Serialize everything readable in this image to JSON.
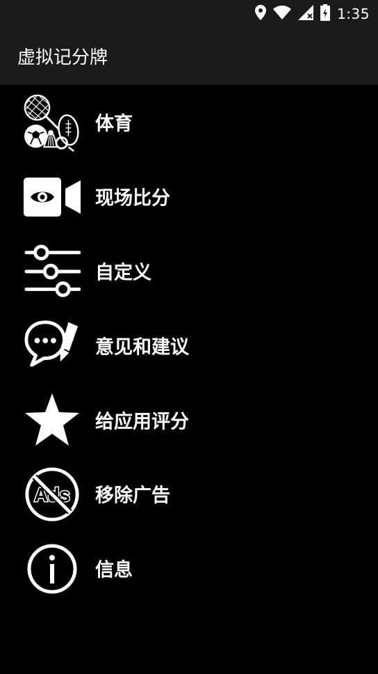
{
  "status_bar": {
    "time": "1:35"
  },
  "app_bar": {
    "title": "虚拟记分牌"
  },
  "menu": {
    "items": [
      {
        "label": "体育",
        "icon": "sports-icon"
      },
      {
        "label": "现场比分",
        "icon": "live-camera-icon"
      },
      {
        "label": "自定义",
        "icon": "sliders-icon"
      },
      {
        "label": "意见和建议",
        "icon": "feedback-chat-icon"
      },
      {
        "label": "给应用评分",
        "icon": "star-icon"
      },
      {
        "label": "移除广告",
        "icon": "no-ads-icon"
      },
      {
        "label": "信息",
        "icon": "info-icon"
      }
    ]
  },
  "colors": {
    "background": "#000000",
    "bar": "#1b1b1b",
    "text": "#ffffff"
  }
}
